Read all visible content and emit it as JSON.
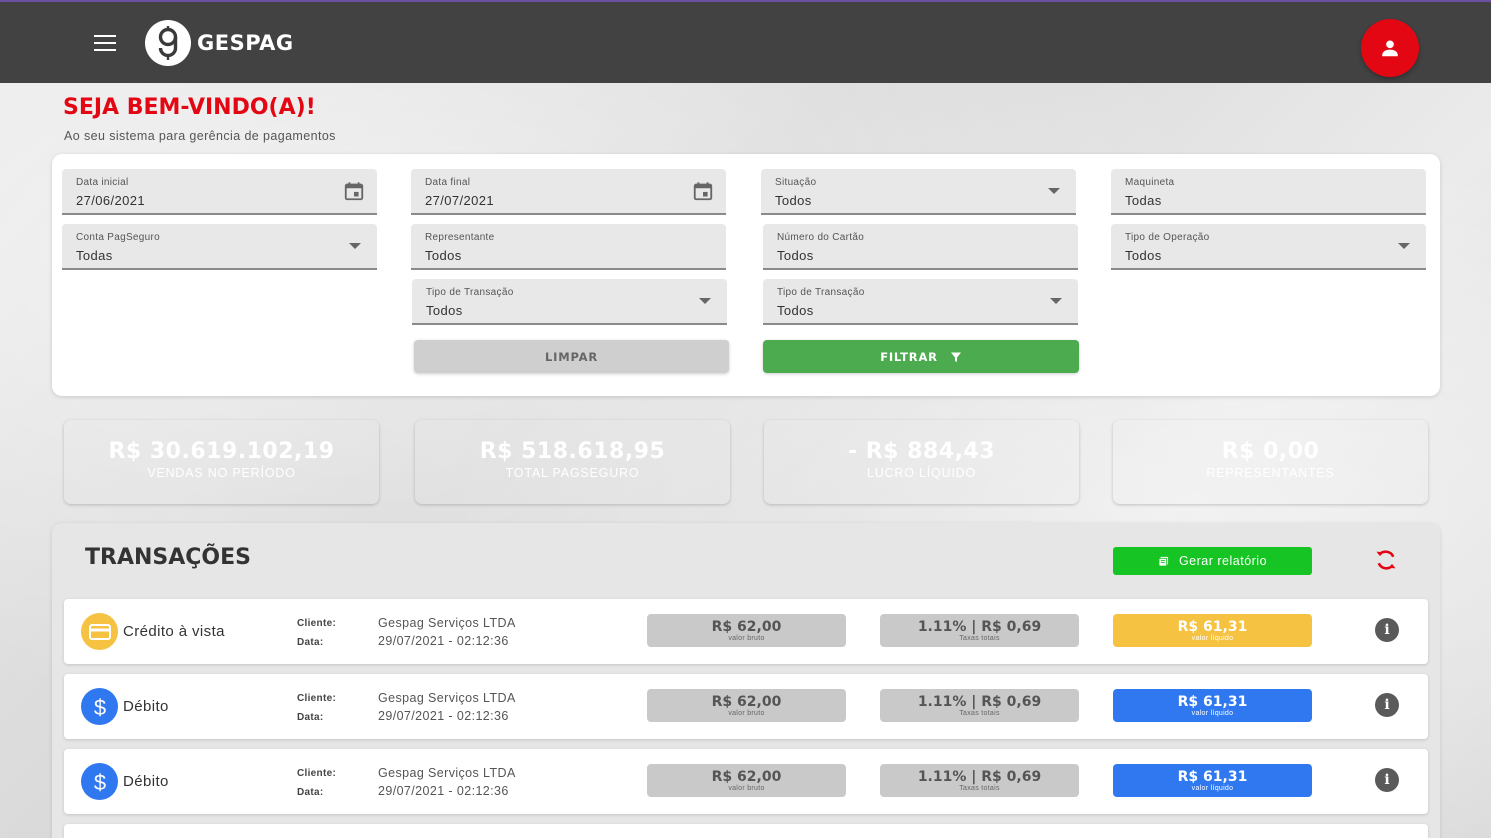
{
  "header": {
    "brand": "GESPAG",
    "logo_glyph": "g",
    "menu_icon": "menu-icon",
    "account_icon": "person-icon"
  },
  "welcome": {
    "title": "SEJA BEM-VINDO(A)!",
    "subtitle": "Ao seu sistema para gerência de pagamentos"
  },
  "filters": {
    "data_inicial": {
      "label": "Data inicial",
      "value": "27/06/2021"
    },
    "data_final": {
      "label": "Data final",
      "value": "27/07/2021"
    },
    "situacao": {
      "label": "Situação",
      "value": "Todos"
    },
    "maquineta": {
      "label": "Maquineta",
      "value": "Todas"
    },
    "conta_pagseguro": {
      "label": "Conta PagSeguro",
      "value": "Todas"
    },
    "representante": {
      "label": "Representante",
      "value": "Todos"
    },
    "numero_cartao": {
      "label": "Número do Cartão",
      "value": "Todos"
    },
    "tipo_operacao": {
      "label": "Tipo de Operação",
      "value": "Todos"
    },
    "tipo_transacao_1": {
      "label": "Tipo de Transação",
      "value": "Todos"
    },
    "tipo_transacao_2": {
      "label": "Tipo de Transação",
      "value": "Todos"
    },
    "clear_label": "LIMPAR",
    "filter_label": "FILTRAR"
  },
  "stats": [
    {
      "value": "R$ 30.619.102,19",
      "label": "VENDAS NO PERÍODO",
      "color": "#e2626f"
    },
    {
      "value": "R$ 518.618,95",
      "label": "TOTAL PAGSEGURO",
      "color": "#c24b5a"
    },
    {
      "value": "- R$ 884,43",
      "label": "LUCRO LÍQUIDO",
      "color": "#9d3744"
    },
    {
      "value": "R$ 0,00",
      "label": "REPRESENTANTES",
      "color": "#7f2b35"
    }
  ],
  "transactions": {
    "title": "TRANSAÇÕES",
    "report_label": "Gerar relatório",
    "cliente_label": "Cliente:",
    "data_label": "Data:",
    "gross_caption": "valor bruto",
    "fees_caption": "Taxas totais",
    "net_caption": "valor líquido",
    "rows": [
      {
        "type": "Crédito à vista",
        "icon": "credit-card-icon",
        "icon_color": "#f5c242",
        "client": "Gespag Serviços LTDA",
        "date": "29/07/2021 - 02:12:36",
        "gross": "R$ 62,00",
        "fees": "1.11% | R$ 0,69",
        "net": "R$ 61,31",
        "net_color": "#f5c242"
      },
      {
        "type": "Débito",
        "icon": "dollar-icon",
        "icon_color": "#2f78f0",
        "client": "Gespag Serviços LTDA",
        "date": "29/07/2021 - 02:12:36",
        "gross": "R$ 62,00",
        "fees": "1.11% | R$ 0,69",
        "net": "R$ 61,31",
        "net_color": "#2f78f0"
      },
      {
        "type": "Débito",
        "icon": "dollar-icon",
        "icon_color": "#2f78f0",
        "client": "Gespag Serviços LTDA",
        "date": "29/07/2021 - 02:12:36",
        "gross": "R$ 62,00",
        "fees": "1.11% | R$ 0,69",
        "net": "R$ 61,31",
        "net_color": "#2f78f0"
      }
    ]
  }
}
